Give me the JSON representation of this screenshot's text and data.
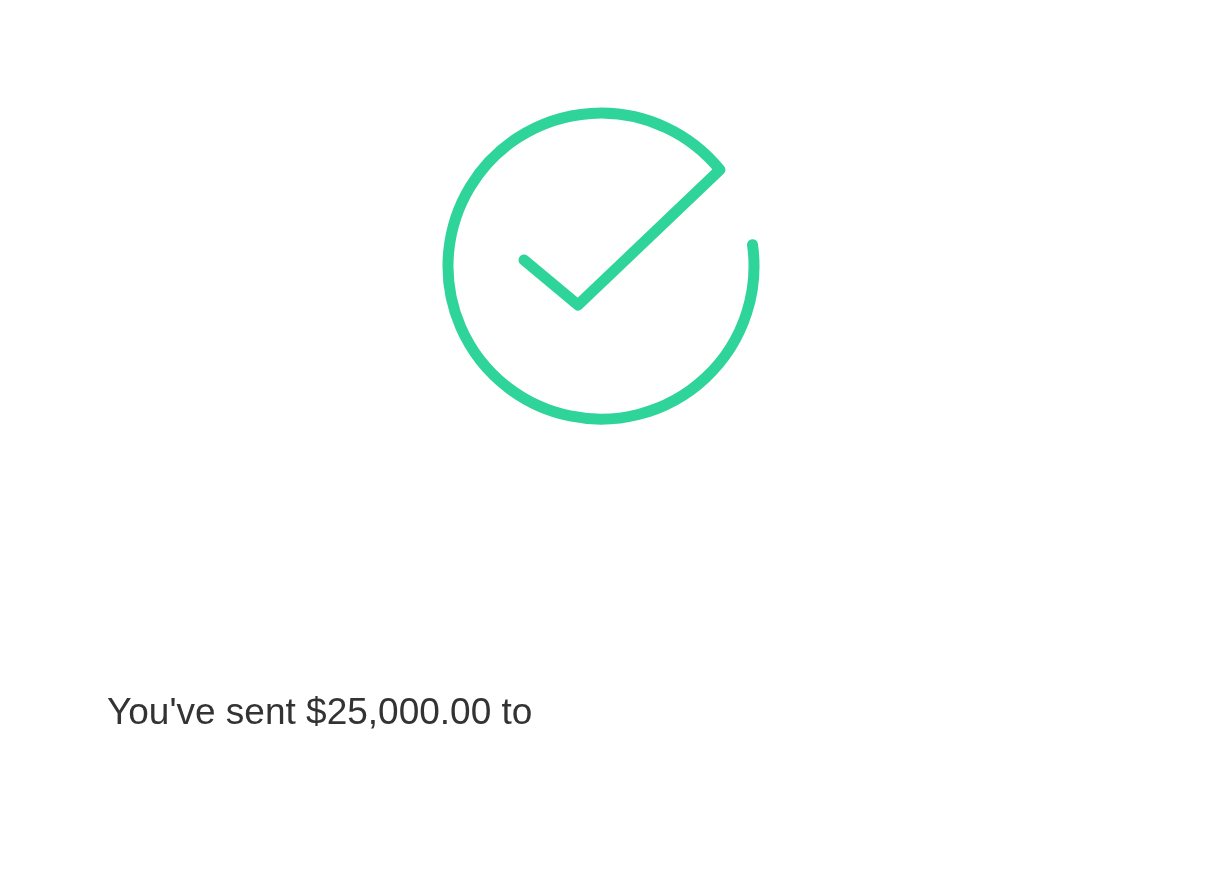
{
  "confirmation": {
    "message": "You've sent $25,000.00 to"
  }
}
